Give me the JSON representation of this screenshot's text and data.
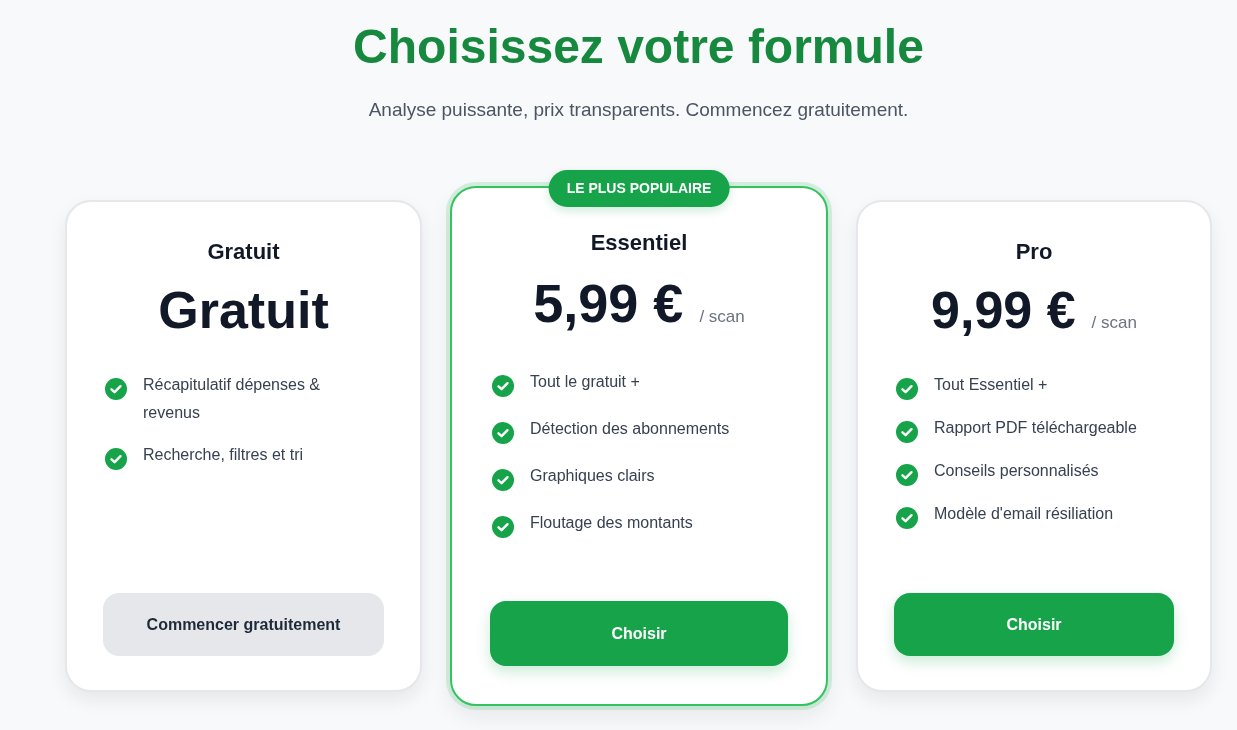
{
  "header": {
    "title": "Choisissez votre formule",
    "subtitle": "Analyse puissante, prix transparents. Commencez gratuitement."
  },
  "plans": [
    {
      "name": "Gratuit",
      "price": "Gratuit",
      "highlighted": false,
      "features": [
        "Récapitulatif dépenses & revenus",
        "Recherche, filtres et tri"
      ],
      "button": {
        "label": "Commencer gratuitement",
        "kind": "secondary"
      }
    },
    {
      "name": "Essentiel",
      "price": "5,99 €",
      "unit": "/ scan",
      "highlighted": true,
      "badge": "LE PLUS POPULAIRE",
      "features": [
        "Tout le gratuit +",
        "Détection des abonnements",
        "Graphiques clairs",
        "Floutage des montants"
      ],
      "button": {
        "label": "Choisir",
        "kind": "primary"
      }
    },
    {
      "name": "Pro",
      "price": "9,99 €",
      "unit": "/ scan",
      "highlighted": false,
      "features": [
        "Tout Essentiel +",
        "Rapport PDF téléchargeable",
        "Conseils personnalisés",
        "Modèle d'email résiliation"
      ],
      "button": {
        "label": "Choisir",
        "kind": "primary"
      }
    }
  ]
}
